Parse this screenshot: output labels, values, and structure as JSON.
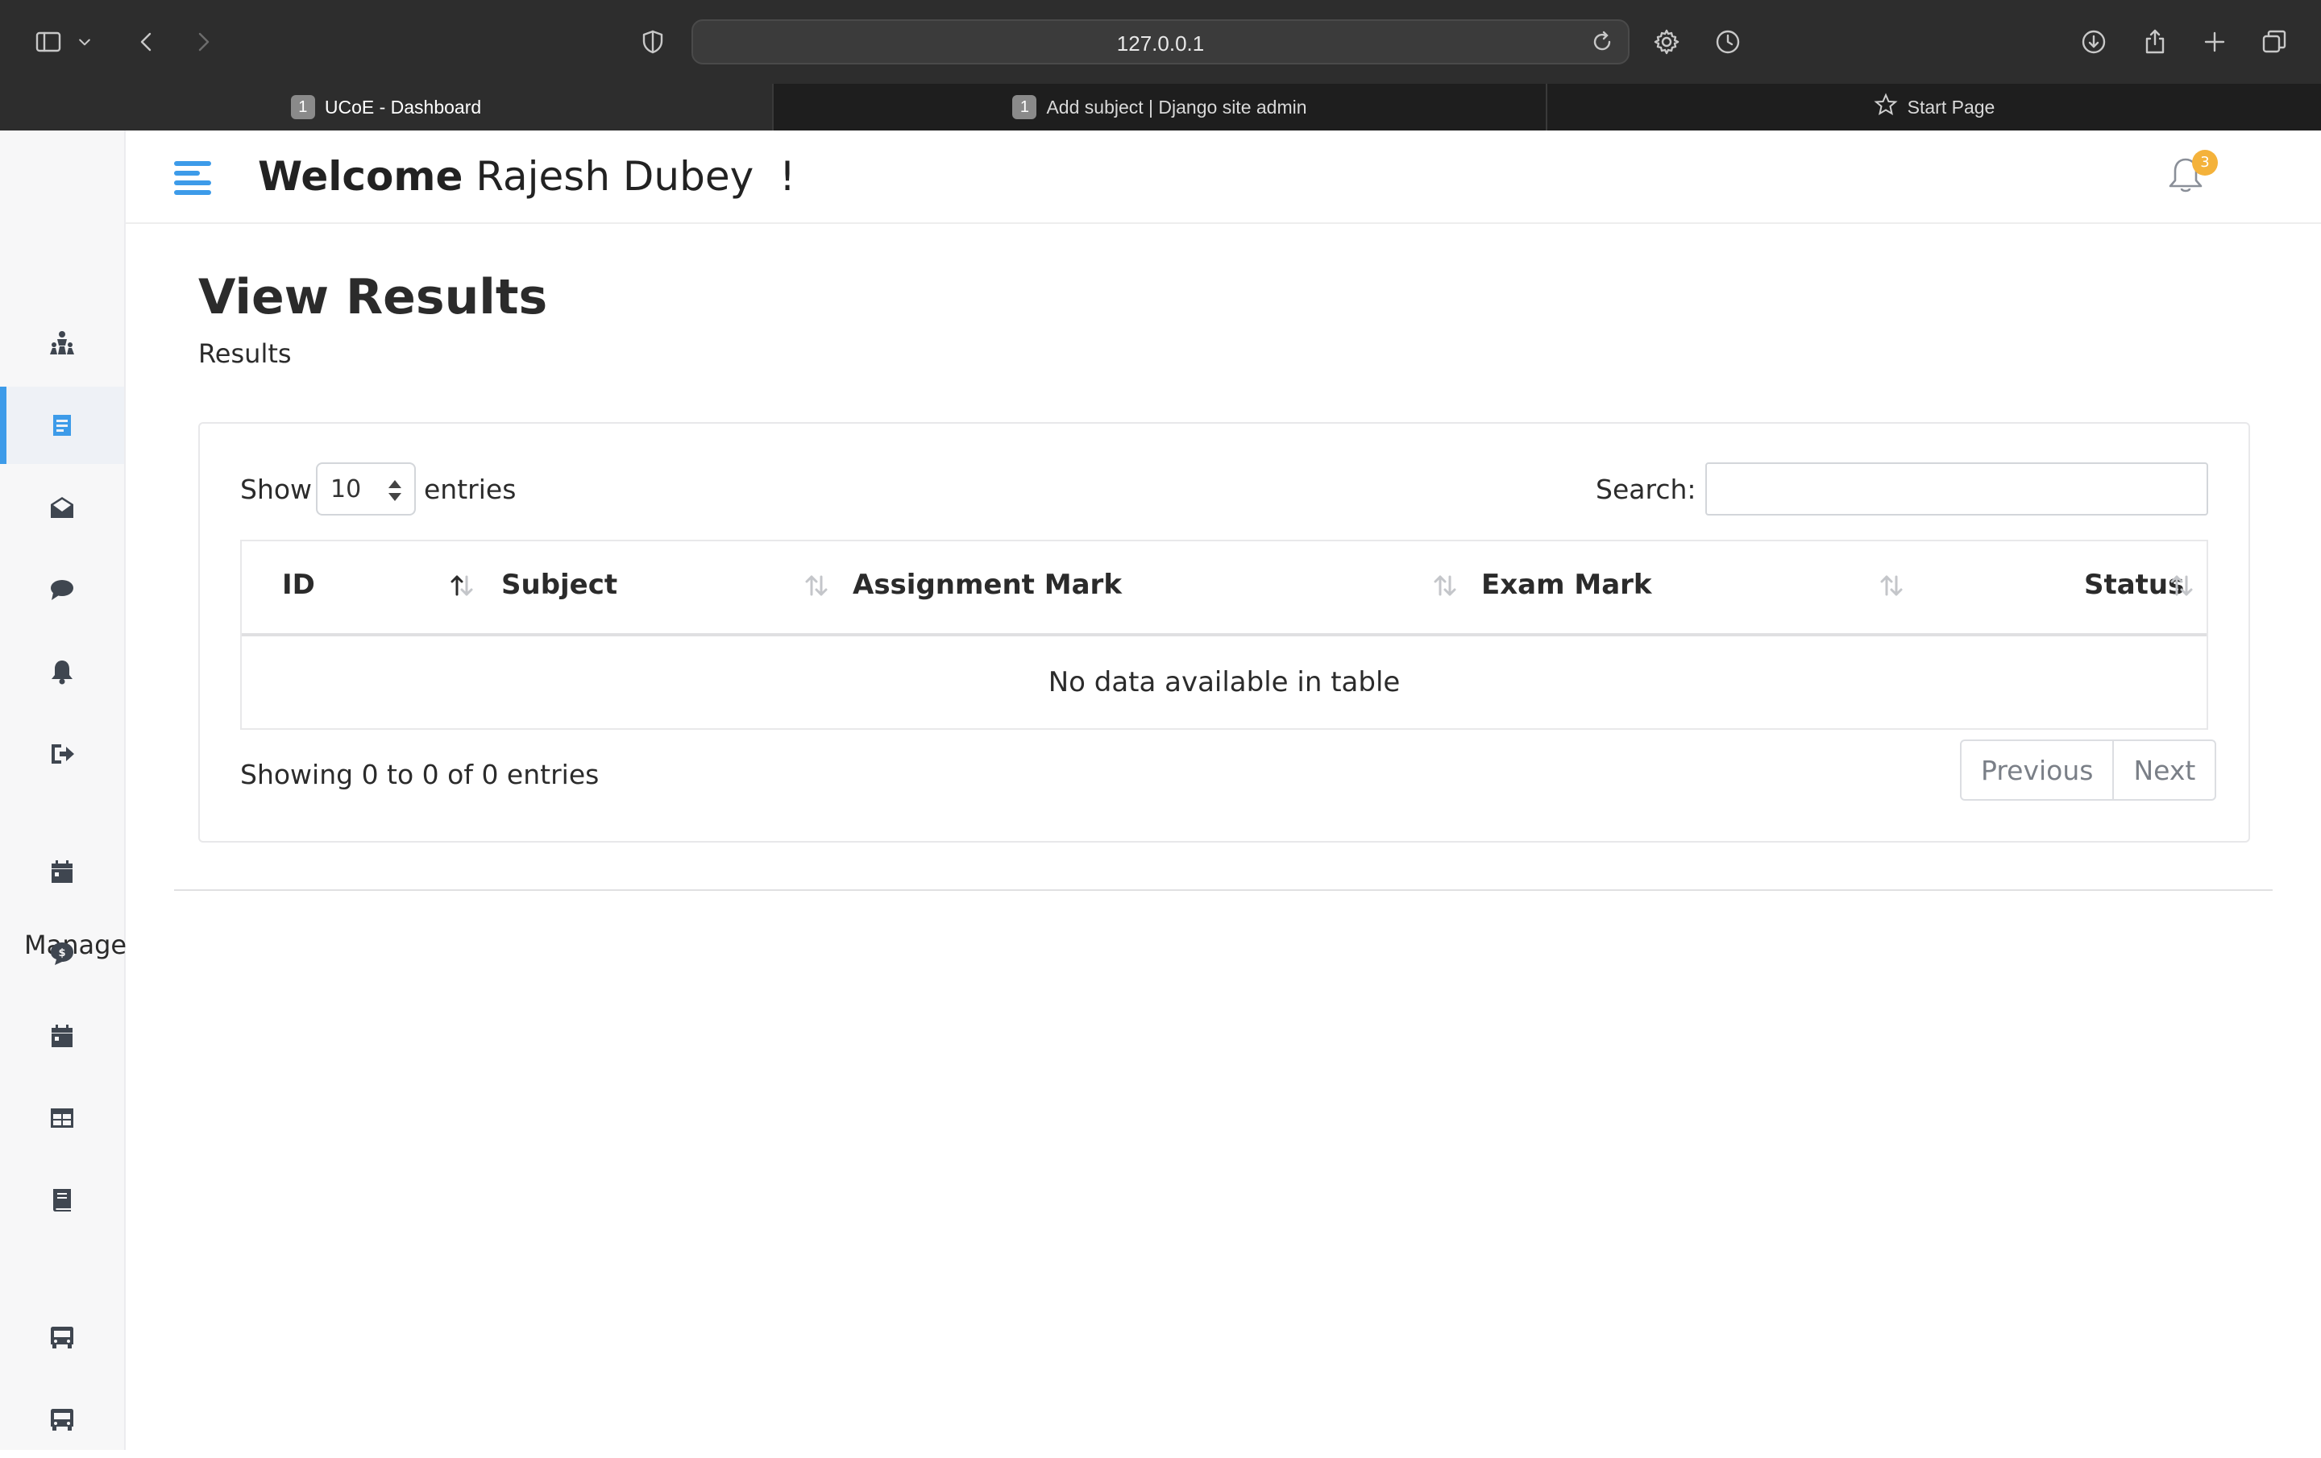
{
  "browser": {
    "url": "127.0.0.1",
    "tabs": [
      {
        "badge": "1",
        "title": "UCoE - Dashboard",
        "active": true
      },
      {
        "badge": "1",
        "title": "Add subject | Django site admin",
        "active": false
      },
      {
        "badge": "",
        "title": "Start Page",
        "active": false
      }
    ]
  },
  "header": {
    "welcome_bold": "Welcome",
    "user_name": "Rajesh Dubey  !",
    "notification_count": "3"
  },
  "sidebar": {
    "manage_heading": "Manage",
    "items": [
      {
        "icon": "dashboard-people-icon"
      },
      {
        "icon": "results-document-icon",
        "active": true
      },
      {
        "icon": "envelope-icon"
      },
      {
        "icon": "chat-bubble-icon"
      },
      {
        "icon": "bell-icon"
      },
      {
        "icon": "logout-icon"
      },
      {
        "icon": "calendar-icon"
      },
      {
        "icon": "fees-dollar-icon"
      },
      {
        "icon": "calendar-icon"
      },
      {
        "icon": "table-icon"
      },
      {
        "icon": "book-icon"
      },
      {
        "icon": "bus-icon"
      },
      {
        "icon": "bus-icon"
      }
    ]
  },
  "page": {
    "title": "View Results",
    "subtitle": "Results"
  },
  "table_controls": {
    "show_label": "Show",
    "entries_value": "10",
    "entries_label": "entries",
    "search_label": "Search:",
    "search_value": ""
  },
  "table": {
    "columns": [
      "ID",
      "Subject",
      "Assignment Mark",
      "Exam Mark",
      "Status"
    ],
    "empty_message": "No data available in table"
  },
  "footer": {
    "info": "Showing 0 to 0 of 0 entries",
    "previous": "Previous",
    "next": "Next"
  },
  "colors": {
    "accent": "#3d9be9",
    "badge": "#f4b23b"
  }
}
